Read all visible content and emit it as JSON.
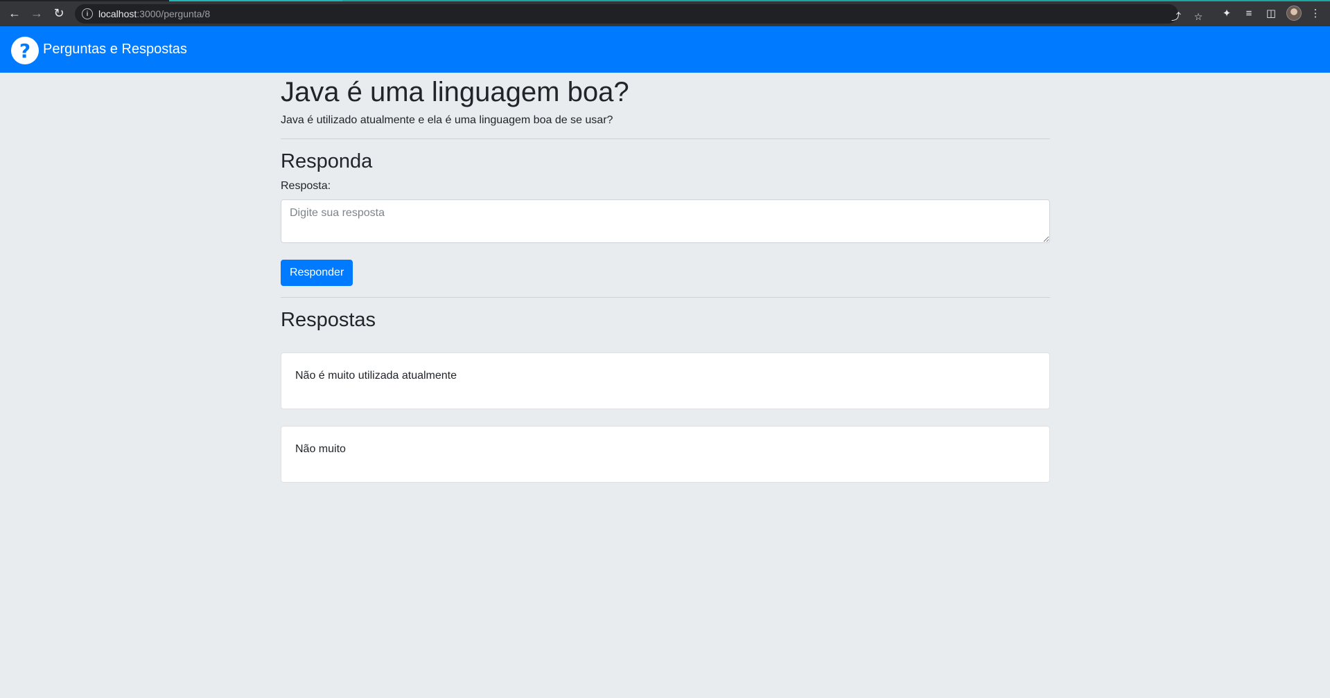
{
  "browser": {
    "url_host": "localhost",
    "url_path": ":3000/pergunta/8",
    "back_icon": "arrow-left-icon",
    "forward_icon": "arrow-right-icon",
    "reload_icon": "reload-icon"
  },
  "navbar": {
    "brand_logo": "?",
    "brand_text": "Perguntas e Respostas",
    "color": "#007bff"
  },
  "question": {
    "title": "Java é uma linguagem boa?",
    "description": "Java é utilizado atualmente e ela é uma linguagem boa de se usar?"
  },
  "answer_form": {
    "heading": "Responda",
    "label": "Resposta:",
    "placeholder": "Digite sua resposta",
    "value": "",
    "submit_label": "Responder"
  },
  "answers": {
    "heading": "Respostas",
    "items": [
      {
        "text": "Não é muito utilizada atualmente"
      },
      {
        "text": "Não muito"
      }
    ]
  }
}
